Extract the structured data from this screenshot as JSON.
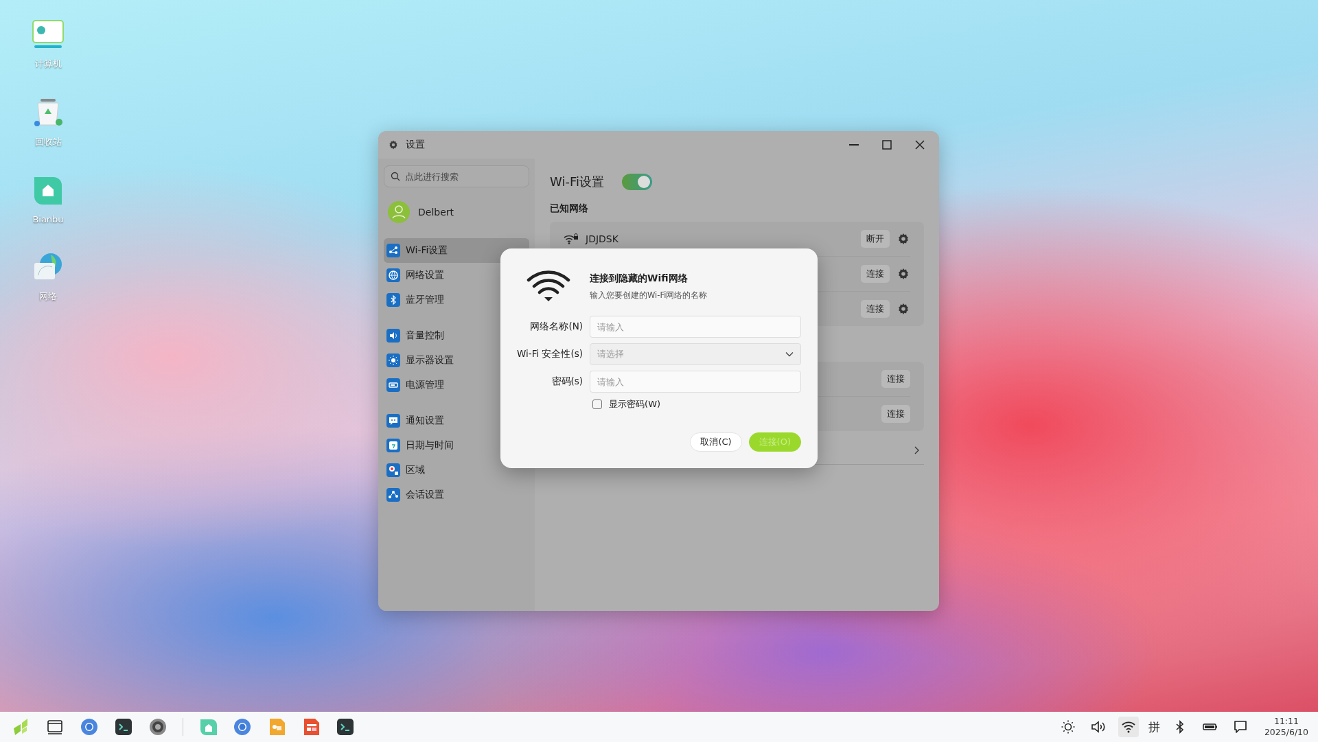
{
  "desktop_icons": [
    {
      "label": "计算机",
      "kind": "computer"
    },
    {
      "label": "回收站",
      "kind": "trash"
    },
    {
      "label": "Bianbu",
      "kind": "home"
    },
    {
      "label": "网络",
      "kind": "network"
    }
  ],
  "settings_window": {
    "title": "设置",
    "search": {
      "placeholder": "点此进行搜索"
    },
    "user": {
      "name": "Delbert"
    },
    "sidebar_groups": [
      {
        "items": [
          {
            "label": "Wi-Fi设置",
            "selected": true
          },
          {
            "label": "网络设置",
            "selected": false
          },
          {
            "label": "蓝牙管理",
            "selected": false
          }
        ]
      },
      {
        "items": [
          {
            "label": "音量控制",
            "selected": false
          },
          {
            "label": "显示器设置",
            "selected": false
          },
          {
            "label": "电源管理",
            "selected": false
          }
        ]
      },
      {
        "items": [
          {
            "label": "通知设置",
            "selected": false
          },
          {
            "label": "日期与时间",
            "selected": false
          },
          {
            "label": "区域",
            "selected": false
          },
          {
            "label": "会话设置",
            "selected": false
          }
        ]
      }
    ],
    "content": {
      "title": "Wi-Fi设置",
      "wifi_enabled": true,
      "known_heading": "已知网络",
      "known_networks": [
        {
          "name": "JDJDSK",
          "action": "断开"
        },
        {
          "action": "连接"
        },
        {
          "action": "连接"
        }
      ],
      "other_networks": [
        {
          "action": "连接"
        },
        {
          "action": "连接"
        }
      ]
    }
  },
  "dialog": {
    "title": "连接到隐藏的Wifi网络",
    "subtitle": "输入您要创建的Wi-Fi网络的名称",
    "fields": [
      {
        "label": "网络名称(N)",
        "kind": "text",
        "placeholder": "请输入"
      },
      {
        "label": "Wi-Fi 安全性(s)",
        "kind": "select",
        "placeholder": "请选择"
      },
      {
        "label": "密码(s)",
        "kind": "password",
        "placeholder": "请输入"
      }
    ],
    "show_password": {
      "label": "显示密码(W)",
      "checked": false
    },
    "buttons": [
      {
        "label": "取消(C)",
        "kind": "cancel",
        "disabled": false
      },
      {
        "label": "连接(O)",
        "kind": "primary",
        "disabled": true
      }
    ]
  },
  "taskbar": {
    "input_method": "拼",
    "time": "11:11",
    "date": "2025/6/10"
  }
}
